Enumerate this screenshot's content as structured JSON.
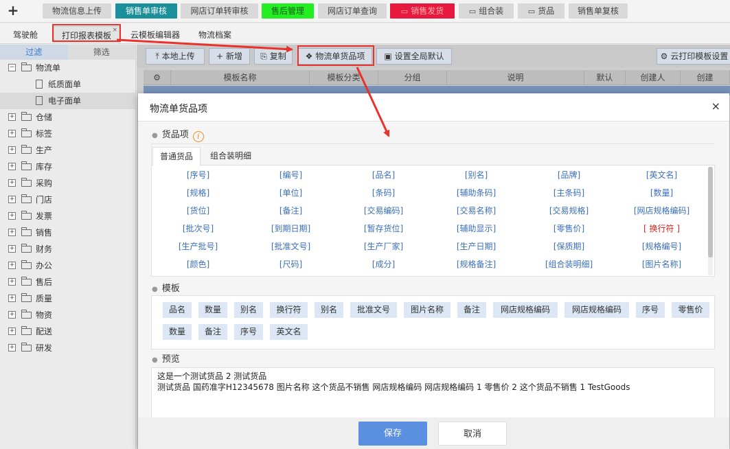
{
  "topnav": {
    "plus": "+",
    "tabs": [
      {
        "label": "物流信息上传",
        "bg": "#d9d9d9",
        "color": "#444"
      },
      {
        "label": "销售单审核",
        "bg": "#1b8f9a",
        "color": "#ffffff"
      },
      {
        "label": "网店订单转审核",
        "bg": "#d9d9d9",
        "color": "#444"
      },
      {
        "label": "售后管理",
        "bg": "#22ee22",
        "color": "#1a5a1a"
      },
      {
        "label": "网店订单查询",
        "bg": "#d9d9d9",
        "color": "#444"
      },
      {
        "label": "销售发货",
        "bg": "#e8193f",
        "color": "#ffb0b0"
      },
      {
        "label": "组合装",
        "bg": "#d9d9d9",
        "color": "#444"
      },
      {
        "label": "货品",
        "bg": "#d9d9d9",
        "color": "#444"
      },
      {
        "label": "销售单复核",
        "bg": "#d9d9d9",
        "color": "#444"
      }
    ]
  },
  "subtabs": [
    "驾驶舱",
    "打印报表模板",
    "云模板编辑器",
    "物流档案"
  ],
  "sidebar": {
    "tabs": [
      "过滤",
      "筛选"
    ],
    "tree": [
      {
        "label": "物流单",
        "open": true
      },
      {
        "label": "纸质面单",
        "child": true
      },
      {
        "label": "电子面单",
        "child": true,
        "selected": true
      },
      {
        "label": "仓储"
      },
      {
        "label": "标签"
      },
      {
        "label": "生产"
      },
      {
        "label": "库存"
      },
      {
        "label": "采购"
      },
      {
        "label": "门店"
      },
      {
        "label": "发票"
      },
      {
        "label": "销售"
      },
      {
        "label": "财务"
      },
      {
        "label": "办公"
      },
      {
        "label": "售后"
      },
      {
        "label": "质量"
      },
      {
        "label": "物资"
      },
      {
        "label": "配送"
      },
      {
        "label": "研发"
      }
    ]
  },
  "toolbar": {
    "upload": "本地上传",
    "add": "新增",
    "copy": "复制",
    "goods_items": "物流单货品项",
    "set_default": "设置全局默认",
    "cloud_settings": "云打印模板设置"
  },
  "grid": {
    "headers": [
      "模板名称",
      "模板分类",
      "分组",
      "说明",
      "默认",
      "创建人",
      "创建"
    ]
  },
  "modal": {
    "title": "物流单货品项",
    "close": "×",
    "goods_section": "货品项",
    "goods_tabs": [
      "普通货品",
      "组合装明细"
    ],
    "fields": [
      "[序号]",
      "[编号]",
      "[品名]",
      "[别名]",
      "[品牌]",
      "[英文名]",
      "[规格]",
      "[单位]",
      "[条码]",
      "[辅助条码]",
      "[主条码]",
      "[数量]",
      "[货位]",
      "[备注]",
      "[交易编码]",
      "[交易名称]",
      "[交易规格]",
      "[网店规格编码]",
      "[批次号]",
      "[到期日期]",
      "[暂存货位]",
      "[辅助显示]",
      "[零售价]",
      "[ 换行符 ]",
      "[生产批号]",
      "[批准文号]",
      "[生产厂家]",
      "[生产日期]",
      "[保质期]",
      "[规格编号]",
      "[颜色]",
      "[尺码]",
      "[成分]",
      "[规格备注]",
      "[组合装明细]",
      "[图片名称]"
    ],
    "template_section": "模板",
    "template_chips_row1": [
      "品名",
      "数量",
      "别名",
      "换行符",
      "别名",
      "批准文号",
      "图片名称",
      "备注",
      "网店规格编码",
      "网店规格编码",
      "序号",
      "零售价"
    ],
    "template_chips_row2": [
      "数量",
      "备注",
      "序号",
      "英文名"
    ],
    "preview_section": "预览",
    "preview_line1": "这是一个测试货品 2 测试货品",
    "preview_line2": "测试货品 国药准字H12345678 图片名称 这个货品不销售 网店规格编码 网店规格编码 1 零售价 2 这个货品不销售 1 TestGoods",
    "save": "保存",
    "cancel": "取消"
  }
}
